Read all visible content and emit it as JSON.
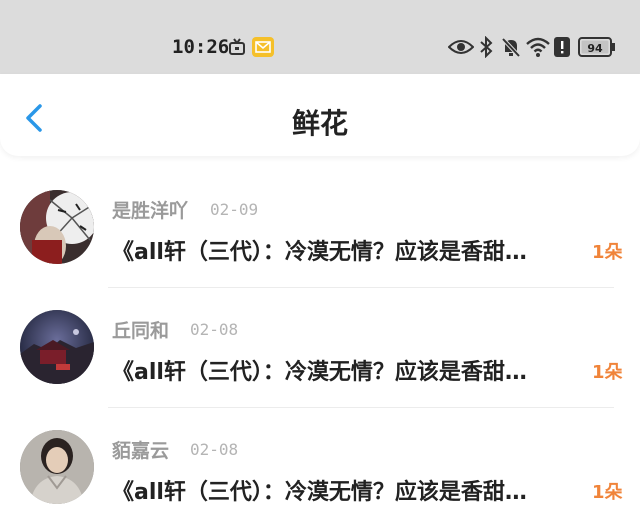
{
  "status_bar": {
    "time": "10:26",
    "battery": "94",
    "icons": [
      "tv-icon",
      "mail-notification-icon",
      "eye-icon",
      "bluetooth-icon",
      "mute-bell-icon",
      "wifi-icon",
      "alert-icon",
      "battery-icon"
    ],
    "colors": {
      "background": "#dcdcdc",
      "mail_icon": "#f5c02a"
    }
  },
  "nav": {
    "title": "鲜花",
    "back_icon": "chevron-left-icon",
    "accent": "#2a97e8"
  },
  "items": [
    {
      "author": "是胜洋吖",
      "date": "02-09",
      "title": "《all轩（三代）：冷漠无情？应该是香甜…",
      "flowers": "1朵"
    },
    {
      "author": "丘同和",
      "date": "02-08",
      "title": "《all轩（三代）：冷漠无情？应该是香甜…",
      "flowers": "1朵"
    },
    {
      "author": "貊嘉云",
      "date": "02-08",
      "title": "《all轩（三代）：冷漠无情？应该是香甜…",
      "flowers": "1朵"
    }
  ],
  "colors": {
    "flowers": "#f0843a",
    "author": "#9a9a9a",
    "date": "#b4b4b4"
  }
}
